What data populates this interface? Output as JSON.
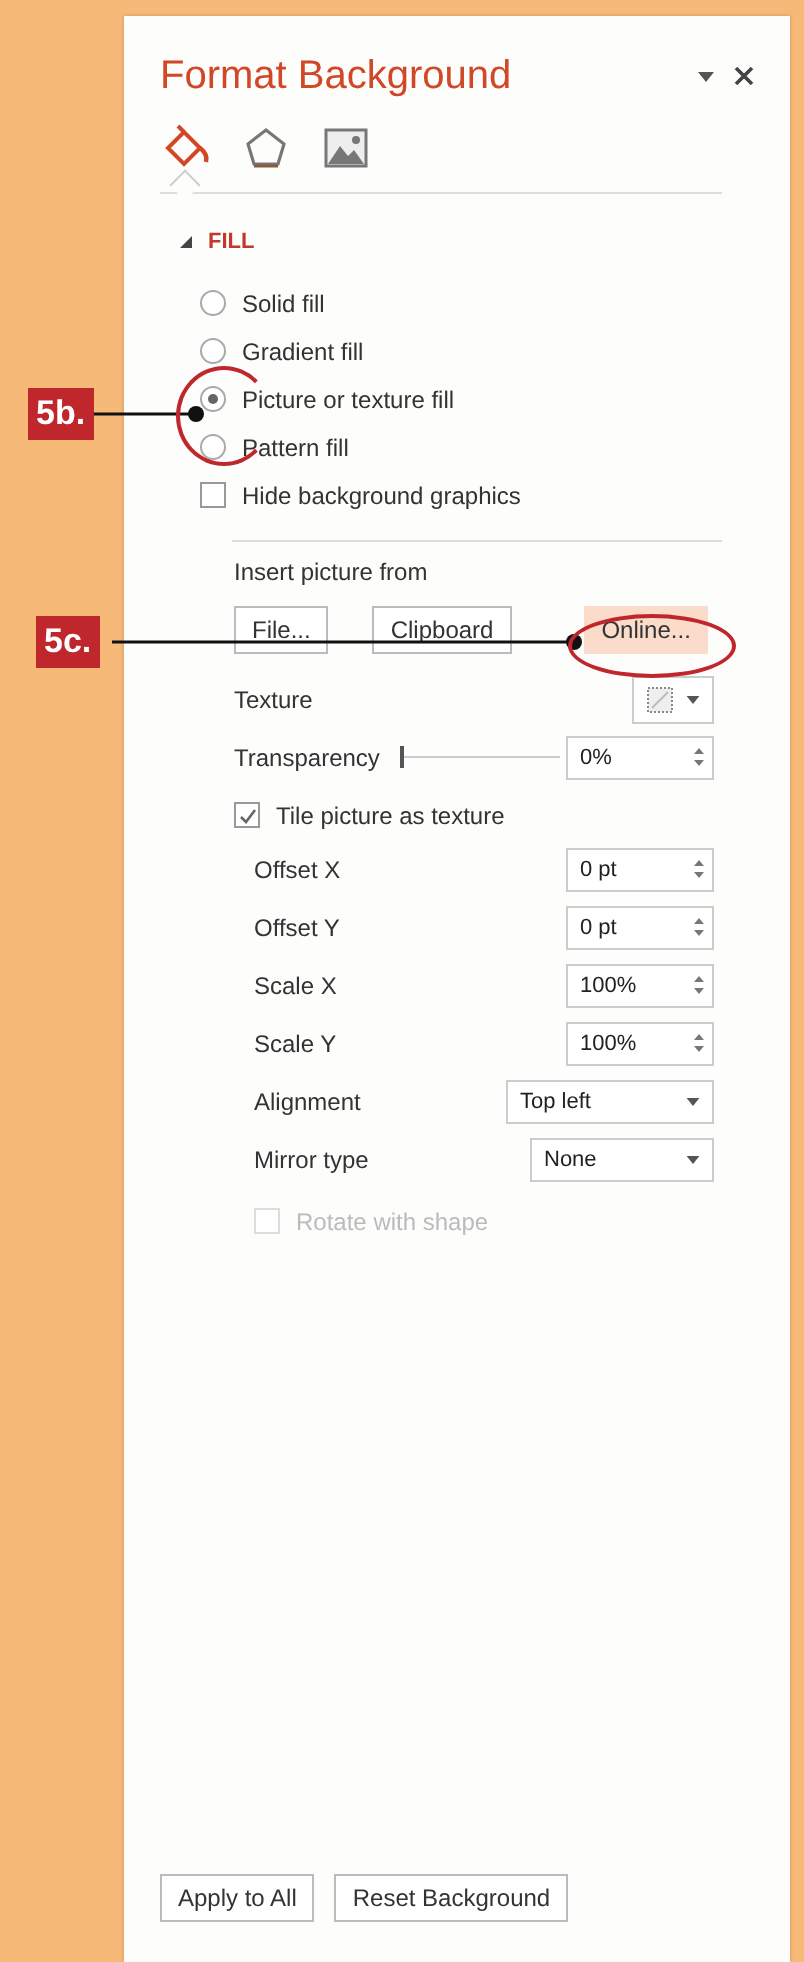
{
  "panel": {
    "title": "Format Background",
    "tabs": [
      {
        "kind": "fill",
        "selected": true
      },
      {
        "kind": "effects",
        "selected": false
      },
      {
        "kind": "picture",
        "selected": false
      }
    ],
    "section": {
      "title": "FILL",
      "expanded": true
    },
    "fill_options": [
      {
        "label": "Solid fill",
        "selected": false
      },
      {
        "label": "Gradient fill",
        "selected": false
      },
      {
        "label": "Picture or texture fill",
        "selected": true
      },
      {
        "label": "Pattern fill",
        "selected": false
      }
    ],
    "hide_background_graphics": {
      "label": "Hide background graphics",
      "checked": false
    },
    "insert_picture": {
      "label": "Insert picture from",
      "buttons": [
        {
          "label": "File...",
          "highlighted": false
        },
        {
          "label": "Clipboard",
          "highlighted": false
        },
        {
          "label": "Online...",
          "highlighted": true
        }
      ]
    },
    "texture": {
      "label": "Texture"
    },
    "transparency": {
      "label": "Transparency",
      "level": 0,
      "value": "0%"
    },
    "tile": {
      "label": "Tile picture as texture",
      "checked": true,
      "disabled": false
    },
    "tile_fields": [
      {
        "kind": "spinner",
        "label": "Offset X",
        "value": "0 pt"
      },
      {
        "kind": "spinner",
        "label": "Offset Y",
        "value": "0 pt"
      },
      {
        "kind": "spinner",
        "label": "Scale X",
        "value": "100%"
      },
      {
        "kind": "spinner",
        "label": "Scale Y",
        "value": "100%"
      },
      {
        "kind": "dropdown",
        "label": "Alignment",
        "value": "Top left"
      },
      {
        "kind": "dropdown",
        "label": "Mirror type",
        "value": "None"
      }
    ],
    "rotate": {
      "label": "Rotate with shape",
      "checked": false,
      "disabled": true
    },
    "footer_buttons": [
      "Apply to All",
      "Reset Background"
    ]
  },
  "callouts": [
    {
      "label": "5b.",
      "kind": "radio"
    },
    {
      "label": "5c.",
      "kind": "button"
    }
  ]
}
